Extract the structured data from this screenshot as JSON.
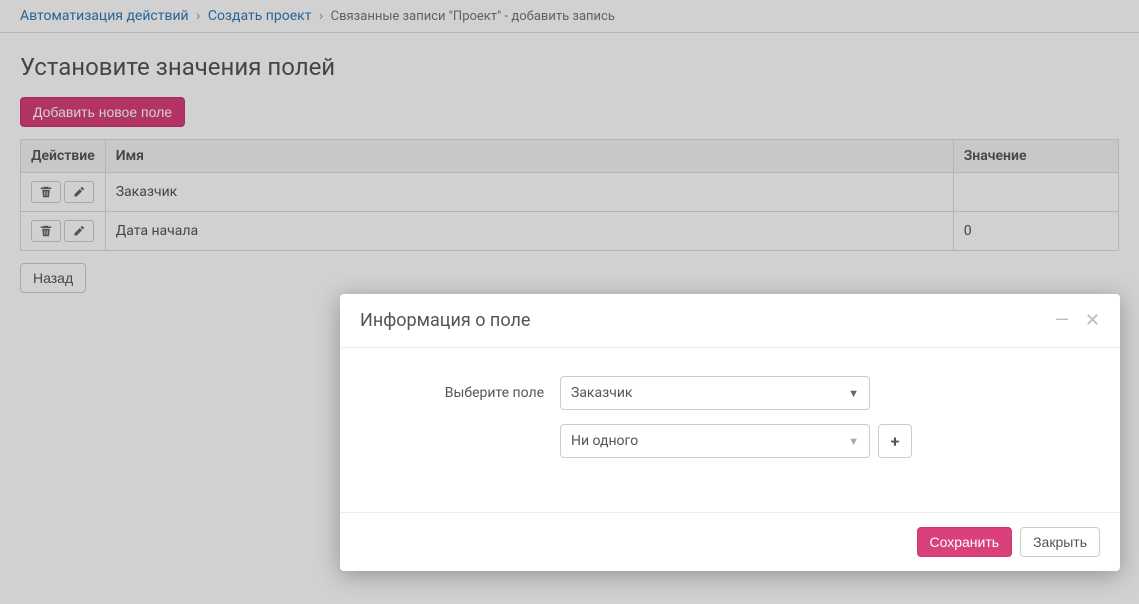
{
  "breadcrumb": {
    "items": [
      {
        "label": "Автоматизация действий",
        "link": true
      },
      {
        "label": "Создать проект",
        "link": true
      },
      {
        "label": "Связанные записи \"Проект\" - добавить запись",
        "link": false
      }
    ]
  },
  "page": {
    "title": "Установите значения полей",
    "add_button": "Добавить новое поле",
    "back_button": "Назад"
  },
  "table": {
    "headers": {
      "action": "Действие",
      "name": "Имя",
      "value": "Значение"
    },
    "rows": [
      {
        "name": "Заказчик",
        "value": ""
      },
      {
        "name": "Дата начала",
        "value": "0"
      }
    ]
  },
  "modal": {
    "title": "Информация о поле",
    "field_label": "Выберите поле",
    "field_select": "Заказчик",
    "value_select": "Ни одного",
    "save": "Сохранить",
    "close": "Закрыть"
  }
}
